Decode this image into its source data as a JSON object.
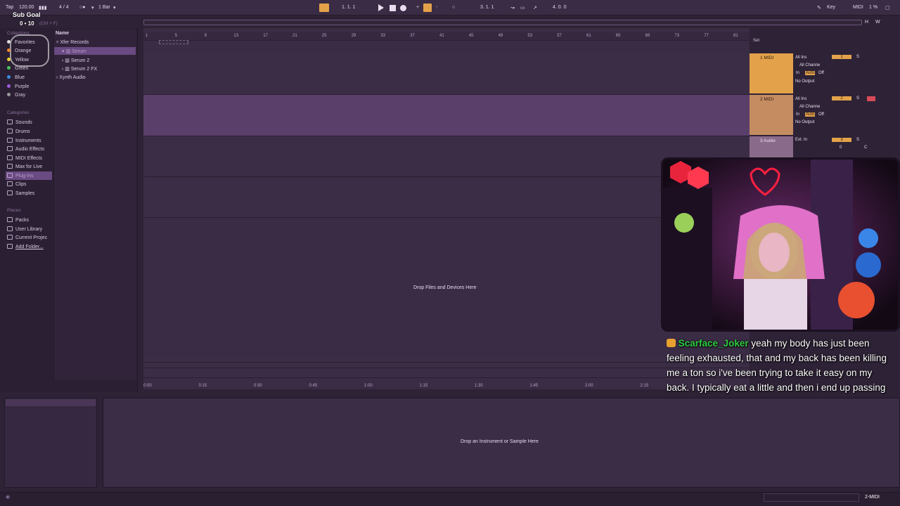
{
  "transport": {
    "tap": "Tap",
    "tempo": "120.00",
    "time_signature": "4 / 4",
    "quantize": "1 Bar",
    "position": "1.   1.   1",
    "loop_start": "3.   1.   1",
    "loop_length": "4.   0.   0",
    "key": "Key",
    "midi": "MIDI",
    "cpu": "1 %"
  },
  "overlay": {
    "sub_goal": "Sub Goal",
    "sub_count": "0 • 10"
  },
  "browser": {
    "collections_heading": "Collections",
    "collections": [
      "Favorites",
      "Orange",
      "Yellow",
      "Green",
      "Blue",
      "Purple",
      "Gray"
    ],
    "categories_heading": "Categories",
    "categories": [
      "Sounds",
      "Drums",
      "Instruments",
      "Audio Effects",
      "MIDI Effects",
      "Max for Live",
      "Plug-Ins",
      "Clips",
      "Samples"
    ],
    "places_heading": "Places",
    "places": [
      "Packs",
      "User Library",
      "Current Projec",
      "Add Folder..."
    ],
    "search_hint": "(Ctrl + F)",
    "name_header": "Name",
    "tree": [
      "▿ Xfer Records",
      "▾ ▥ Serum",
      "› ▥ Serum 2",
      "› ▥ Serum 2 FX",
      "› Xynth Audio"
    ]
  },
  "arrangement": {
    "ruler_bars": [
      "1",
      "5",
      "9",
      "13",
      "17",
      "21",
      "25",
      "29",
      "33",
      "37",
      "41",
      "45",
      "49",
      "53",
      "57",
      "61",
      "65",
      "69",
      "73",
      "77",
      "81"
    ],
    "time_ticks": [
      "0:00",
      "0:15",
      "0:30",
      "0:45",
      "1:00",
      "1:15",
      "1:30",
      "1:45",
      "2:00",
      "2:15"
    ],
    "drop_hint": "Drop Files and Devices Here",
    "h_label": "H",
    "w_label": "W"
  },
  "mixer": {
    "set_label": "Set",
    "monitor_in": "In",
    "monitor_auto": "Auto",
    "monitor_off": "Off",
    "solo": "S",
    "tracks": [
      {
        "name": "1 MIDI",
        "input": "All Ins",
        "channel": "All Channe",
        "output": "No Output",
        "number": "1"
      },
      {
        "name": "2 MIDI",
        "input": "All Ins",
        "channel": "All Channe",
        "output": "No Output",
        "number": "2"
      },
      {
        "name": "3 Audio",
        "input": "Ext. In",
        "number": "3",
        "volume": "0",
        "pan": "C"
      }
    ]
  },
  "chat": {
    "username": "Scarface_Joker",
    "text": "yeah my body has just been feeling exhausted, that and my back has been killing me a ton so i've been trying to take it easy on my back. I typically eat a little and then i end up passing out"
  },
  "detail": {
    "drop_hint": "Drop an Instrument or Sample Here"
  },
  "status": {
    "track": "2-MIDI"
  }
}
